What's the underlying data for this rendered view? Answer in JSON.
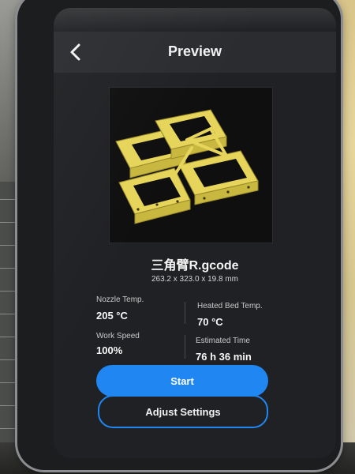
{
  "header": {
    "title": "Preview",
    "back_icon": "chevron-left-icon"
  },
  "file": {
    "name": "三角臂R.gcode",
    "dimensions": "263.2 x 323.0 x 19.8 mm"
  },
  "stats": {
    "nozzle_temp_label": "Nozzle Temp.",
    "nozzle_temp_value": "205 °C",
    "bed_temp_label": "Heated Bed Temp.",
    "bed_temp_value": "70 °C",
    "work_speed_label": "Work Speed",
    "work_speed_value": "100%",
    "estimated_time_label": "Estimated Time",
    "estimated_time_value": "76 h 36 min"
  },
  "actions": {
    "start_label": "Start",
    "adjust_label": "Adjust Settings"
  },
  "colors": {
    "accent": "#1f86f2",
    "model": "#e6d55a",
    "screen_bg": "#202124"
  }
}
